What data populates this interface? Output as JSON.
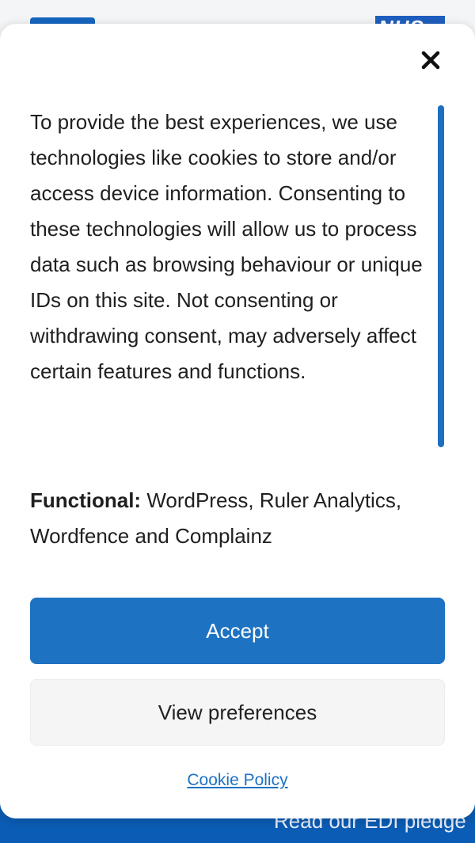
{
  "background": {
    "footer_text": "Read our EDI pledge"
  },
  "cookie_banner": {
    "close_icon": "close-icon",
    "message": "To provide the best experiences, we use technologies like cookies to store and/or access device information. Consenting to these technologies will allow us to process data such as browsing behaviour or unique IDs on this site. Not consenting or withdrawing consent, may adversely affect certain features and functions.",
    "categories": {
      "label": "Functional:",
      "value": " WordPress, Ruler Analytics, Wordfence and Complainz"
    },
    "accept_label": "Accept",
    "preferences_label": "View preferences",
    "policy_link": "Cookie Policy"
  },
  "colors": {
    "accent": "#1e72c2",
    "footer": "#0b5cb4",
    "text": "#1f1f1f"
  }
}
